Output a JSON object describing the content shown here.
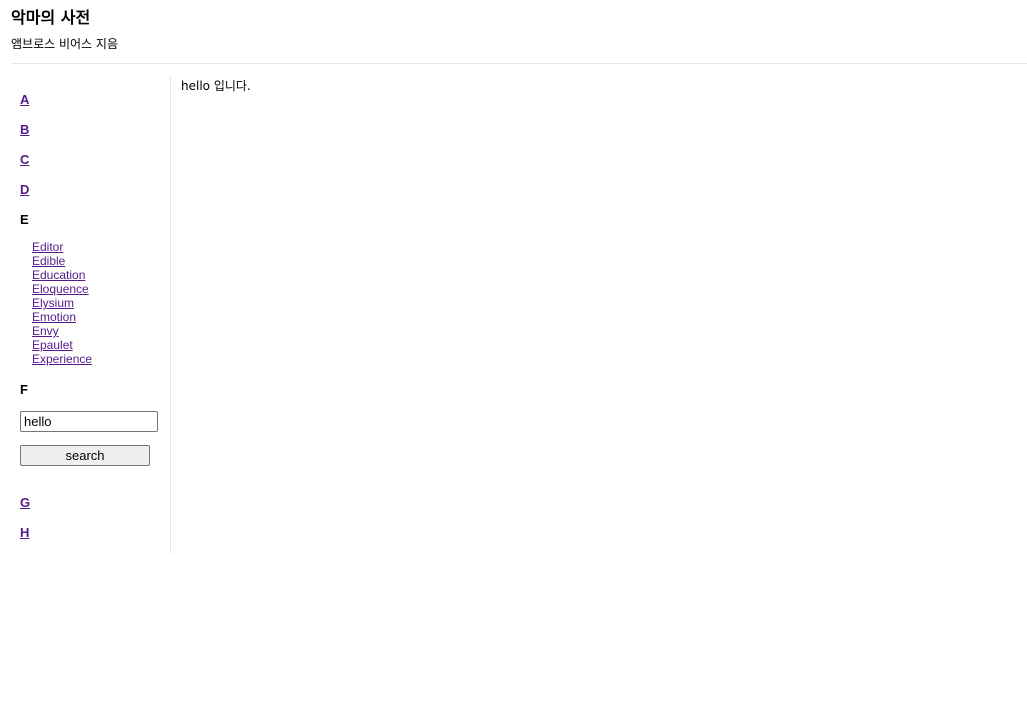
{
  "header": {
    "title": "악마의 사전",
    "subtitle": "앰브로스 비어스 지음"
  },
  "sidebar": {
    "letters_before": [
      "A",
      "B",
      "C",
      "D"
    ],
    "current_letter": "E",
    "words": [
      "Editor",
      "Edible",
      "Education",
      "Eloquence",
      "Elysium",
      "Emotion",
      "Envy",
      "Epaulet",
      "Experience"
    ],
    "letter_f": "F",
    "search": {
      "value": "hello",
      "button_label": "search"
    },
    "letters_after": [
      "G",
      "H"
    ]
  },
  "main": {
    "text": "hello 입니다."
  },
  "colors": {
    "visited_link": "#551a8b",
    "divider": "#e6e6e6"
  }
}
